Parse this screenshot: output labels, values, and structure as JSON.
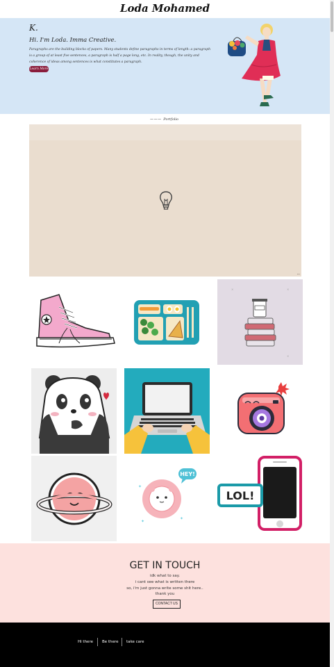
{
  "header": {
    "title": "Loda Mohamed"
  },
  "hero": {
    "initial": "K.",
    "heading": "Hi. I'm Loda. Imma Creative.",
    "paragraph": "Paragraphs are the building blocks of papers. Many students define paragraphs in terms of length: a paragraph is a group of at least five sentences, a paragraph is half a page long, etc. In reality, though, the unity and coherence of ideas among sentences is what constitutes a paragraph.",
    "button_label": "Learn More",
    "illustration": "girl-with-flower-bag"
  },
  "portfolio": {
    "label": "Portfolio",
    "feature": {
      "icon": "lightbulb-icon"
    },
    "items": [
      {
        "icon": "sneaker-icon"
      },
      {
        "icon": "lunch-tray-icon"
      },
      {
        "icon": "coffee-books-icon"
      },
      {
        "icon": "panda-icon"
      },
      {
        "icon": "laptop-icon"
      },
      {
        "icon": "camera-icon"
      },
      {
        "icon": "planet-icon"
      },
      {
        "icon": "lion-icon",
        "speech_text": "HEY!"
      },
      {
        "icon": "phone-lol-icon",
        "speech_text": "LOL!"
      }
    ]
  },
  "contact": {
    "heading": "GET IN TOUCH",
    "lines": [
      "idk what to say.",
      "i cant see what is written there",
      "so, i'm just gonna write some shit here..",
      "thank you"
    ],
    "button_label": "CONTACT US",
    "background": "#fde1de"
  },
  "footer": {
    "links": [
      "Hi there",
      "Be there",
      "take care"
    ],
    "background": "#000000"
  },
  "colors": {
    "hero_background": "#d5e6f6",
    "accent_button": "#8a1d3c",
    "feature_background": "#eaddcf"
  }
}
